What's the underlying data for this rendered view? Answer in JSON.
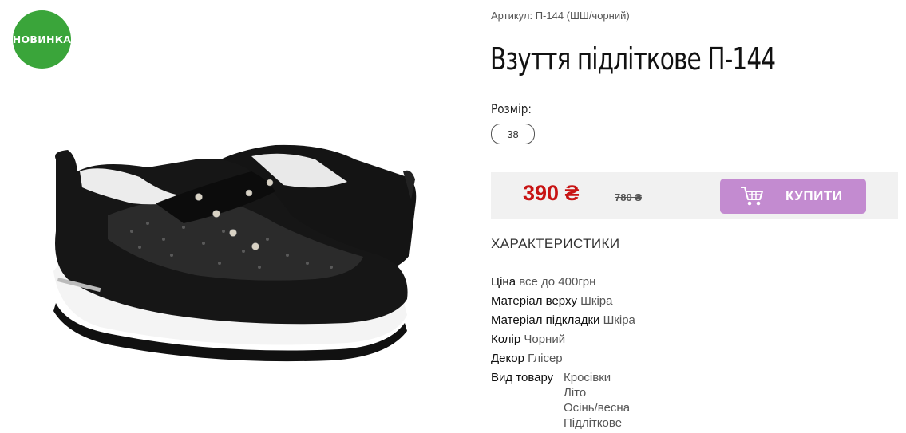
{
  "product": {
    "badge": "НОВИНКА",
    "sku": "Артикул: П-144 (ШШ/чорний)",
    "title": "Взуття підліткове П-144",
    "size_label": "Розмір:",
    "sizes": [
      "38"
    ],
    "price": "390 ₴",
    "old_price": "780 ₴",
    "buy_label": "КУПИТИ",
    "buy_icon": "shopping-cart-icon"
  },
  "specs": {
    "heading": "ХАРАКТЕРИСТИКИ",
    "rows": [
      {
        "key": "Ціна",
        "value": "все до 400грн"
      },
      {
        "key": "Матеріал верху",
        "value": "Шкіра"
      },
      {
        "key": "Матеріал підкладки",
        "value": "Шкіра"
      },
      {
        "key": "Колір",
        "value": "Чорний"
      },
      {
        "key": "Декор",
        "value": "Глісер"
      },
      {
        "key": "Вид товару",
        "values": [
          "Кросівки",
          "Літо",
          "Осінь/весна",
          "Підліткове"
        ]
      }
    ]
  },
  "colors": {
    "badge": "#3aa53a",
    "price": "#c81414",
    "buy_button": "#c38bd0",
    "price_bar": "#f1f1f1"
  }
}
